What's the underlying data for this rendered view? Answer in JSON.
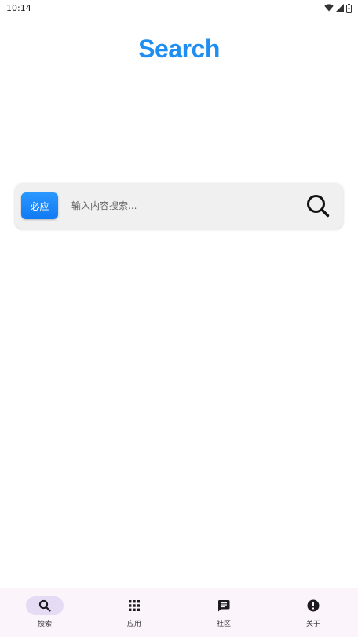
{
  "status_bar": {
    "time": "10:14"
  },
  "logo": {
    "text": "Search",
    "color": "#1e8ff0"
  },
  "search": {
    "engine_label": "必应",
    "placeholder": "输入内容搜索..."
  },
  "bottom_nav": {
    "items": [
      {
        "label": "搜索",
        "icon": "search-icon",
        "active": true
      },
      {
        "label": "应用",
        "icon": "apps-grid-icon",
        "active": false
      },
      {
        "label": "社区",
        "icon": "chat-icon",
        "active": false
      },
      {
        "label": "关于",
        "icon": "info-alert-icon",
        "active": false
      }
    ]
  },
  "colors": {
    "accent": "#1e8ff0",
    "nav_background": "#fbf5fb",
    "nav_active_pill": "#e5dbf4"
  }
}
